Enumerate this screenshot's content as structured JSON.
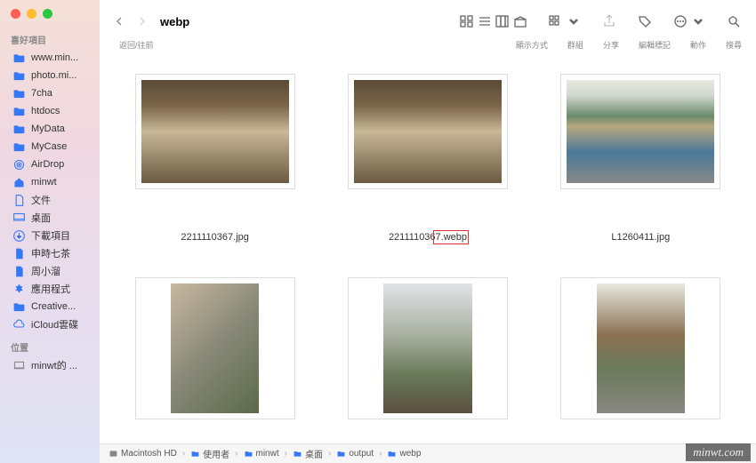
{
  "title": "webp",
  "nav_sub": "返回/往前",
  "toolbar_labels": {
    "view": "顯示方式",
    "group": "群組",
    "share": "分享",
    "tags": "編輯標記",
    "action": "動作",
    "search": "搜尋"
  },
  "sidebar": {
    "fav_header": "喜好項目",
    "loc_header": "位置",
    "items": [
      {
        "name": "www.min...",
        "icon": "folder"
      },
      {
        "name": "photo.mi...",
        "icon": "folder"
      },
      {
        "name": "7cha",
        "icon": "folder"
      },
      {
        "name": "htdocs",
        "icon": "folder"
      },
      {
        "name": "MyData",
        "icon": "folder"
      },
      {
        "name": "MyCase",
        "icon": "folder"
      },
      {
        "name": "AirDrop",
        "icon": "airdrop"
      },
      {
        "name": "minwt",
        "icon": "home"
      },
      {
        "name": "文件",
        "icon": "doc"
      },
      {
        "name": "桌面",
        "icon": "desktop"
      },
      {
        "name": "下載項目",
        "icon": "download"
      },
      {
        "name": "申時七茶",
        "icon": "file"
      },
      {
        "name": "周小溜",
        "icon": "file"
      },
      {
        "name": "應用程式",
        "icon": "apps"
      },
      {
        "name": "Creative...",
        "icon": "folder"
      },
      {
        "name": "iCloud雲碟",
        "icon": "cloud"
      }
    ],
    "loc_items": [
      {
        "name": "minwt的 ...",
        "icon": "laptop"
      }
    ]
  },
  "files": [
    {
      "name": "2211110367.jpg",
      "hl": false,
      "bg": "linear-gradient(180deg,#5a4a35 0%,#7a6548 25%,#c8b898 50%,#6a5a40 100%)"
    },
    {
      "name": "2211110367.webp",
      "hl": true,
      "bg": "linear-gradient(180deg,#5a4a35 0%,#7a6548 25%,#c8b898 50%,#6a5a40 100%)"
    },
    {
      "name": "L1260411.jpg",
      "hl": false,
      "bg": "linear-gradient(180deg,#e8e8e0 0%,#d0d8d0 15%,#6a8a6a 35%,#b8a880 45%,#4a7a98 70%,#888 100%)"
    },
    {
      "name": "",
      "hl": false,
      "bg": "linear-gradient(135deg,#c8b8a0 0%,#888878 50%,#5a6a4a 100%)"
    },
    {
      "name": "",
      "hl": false,
      "bg": "linear-gradient(180deg,#e0e4e8 0%,#a8b0a0 40%,#6a7a5a 70%,#5a5040 100%)"
    },
    {
      "name": "",
      "hl": false,
      "bg": "linear-gradient(180deg,#e8e8e0 0%,#8a7050 40%,#6a7a5a 65%,#888880 100%)"
    }
  ],
  "path": [
    "Macintosh HD",
    "使用者",
    "minwt",
    "桌面",
    "output",
    "webp"
  ],
  "watermark": "minwt.com"
}
